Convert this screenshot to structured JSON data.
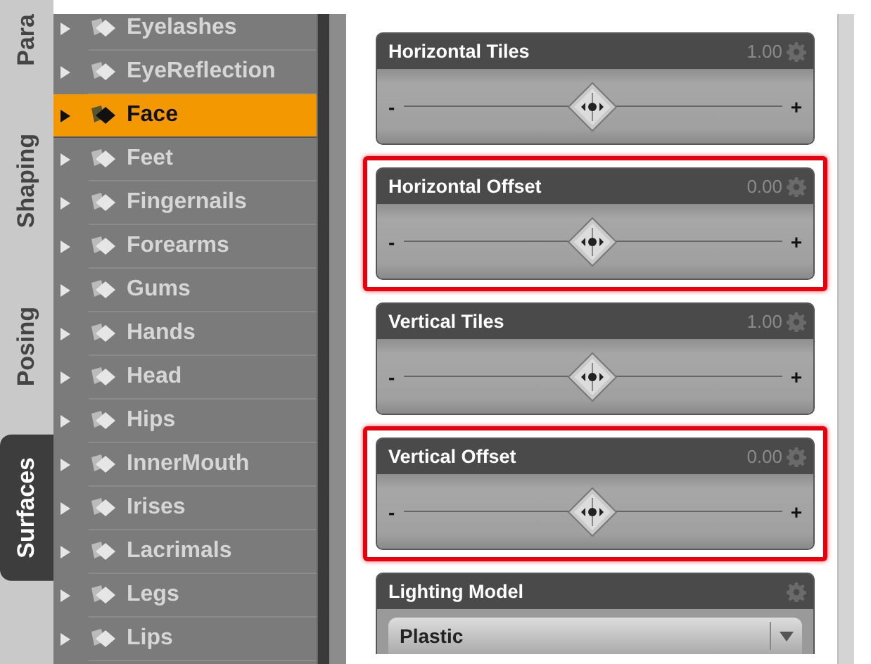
{
  "side_tabs": [
    {
      "label": "Para",
      "selected": false
    },
    {
      "label": "Shaping",
      "selected": false
    },
    {
      "label": "Posing",
      "selected": false
    },
    {
      "label": "Surfaces",
      "selected": true
    }
  ],
  "surfaces": [
    {
      "label": "Eyelashes",
      "selected": false
    },
    {
      "label": "EyeReflection",
      "selected": false
    },
    {
      "label": "Face",
      "selected": true
    },
    {
      "label": "Feet",
      "selected": false
    },
    {
      "label": "Fingernails",
      "selected": false
    },
    {
      "label": "Forearms",
      "selected": false
    },
    {
      "label": "Gums",
      "selected": false
    },
    {
      "label": "Hands",
      "selected": false
    },
    {
      "label": "Head",
      "selected": false
    },
    {
      "label": "Hips",
      "selected": false
    },
    {
      "label": "InnerMouth",
      "selected": false
    },
    {
      "label": "Irises",
      "selected": false
    },
    {
      "label": "Lacrimals",
      "selected": false
    },
    {
      "label": "Legs",
      "selected": false
    },
    {
      "label": "Lips",
      "selected": false
    }
  ],
  "properties": [
    {
      "kind": "slider",
      "title": "Horizontal Tiles",
      "value": "1.00",
      "highlighted": false,
      "level": 0.5,
      "minus": "-",
      "plus": "+"
    },
    {
      "kind": "slider",
      "title": "Horizontal Offset",
      "value": "0.00",
      "highlighted": true,
      "level": 0.5,
      "minus": "-",
      "plus": "+"
    },
    {
      "kind": "slider",
      "title": "Vertical Tiles",
      "value": "1.00",
      "highlighted": false,
      "level": 0.5,
      "minus": "-",
      "plus": "+"
    },
    {
      "kind": "slider",
      "title": "Vertical Offset",
      "value": "0.00",
      "highlighted": true,
      "level": 0.5,
      "minus": "-",
      "plus": "+"
    },
    {
      "kind": "dropdown",
      "title": "Lighting Model",
      "highlighted": false,
      "selection": "Plastic"
    }
  ]
}
